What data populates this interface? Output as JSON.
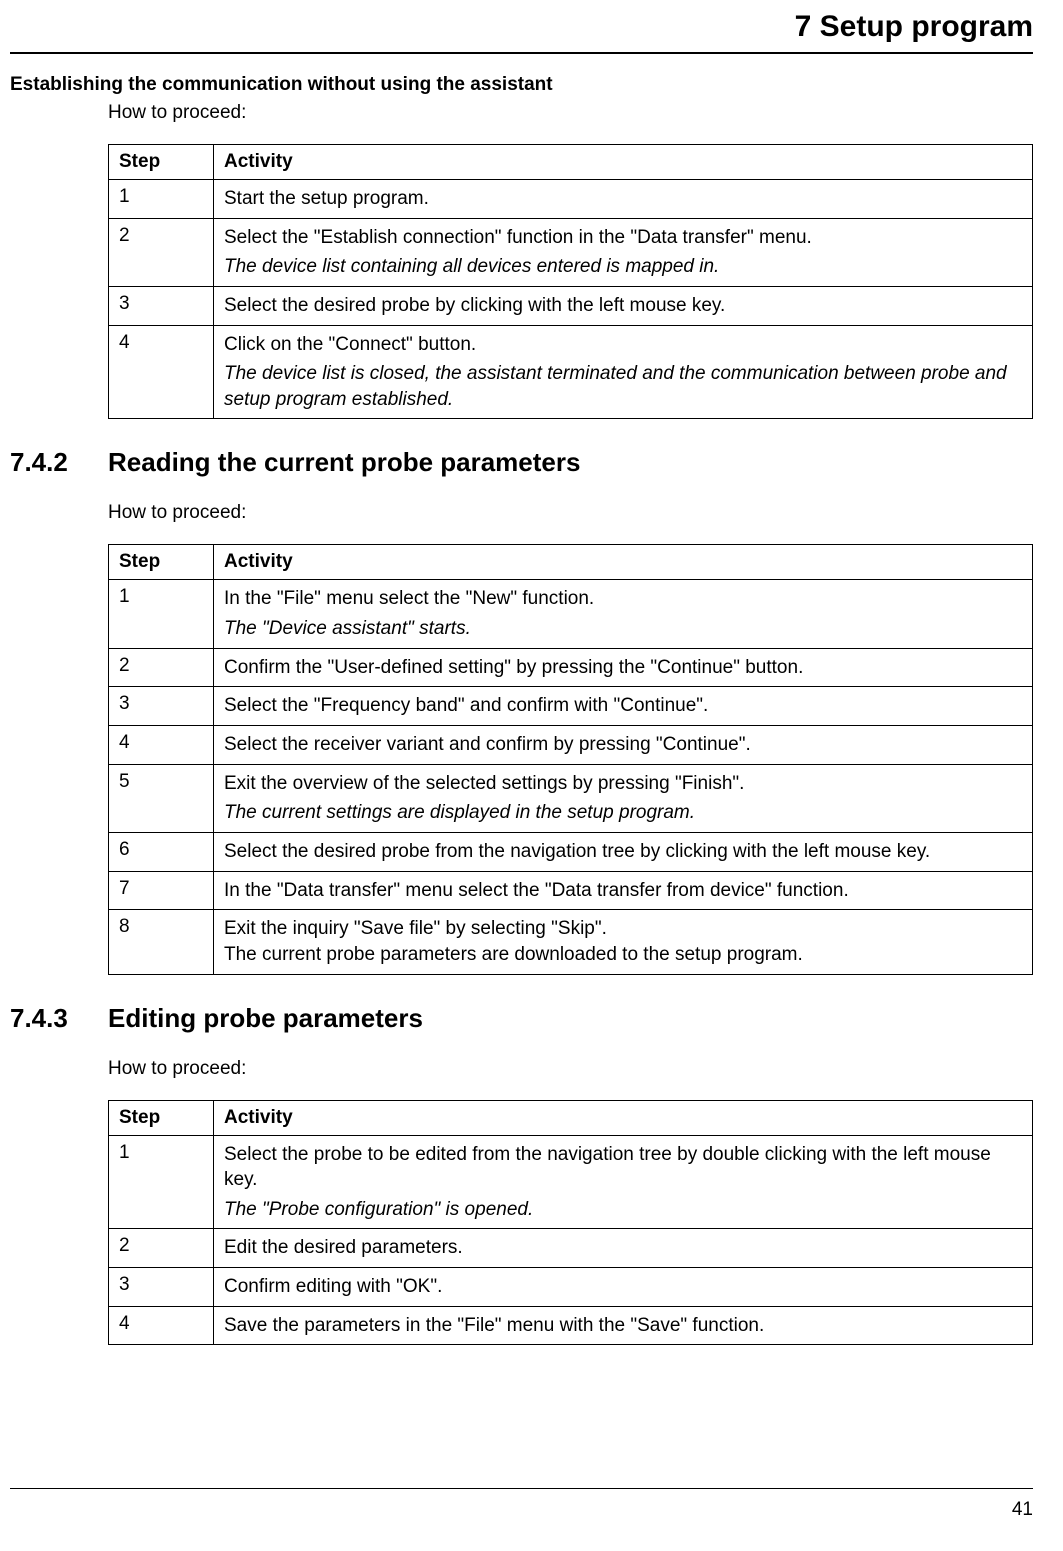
{
  "chapter_title": "7 Setup program",
  "page_number": "41",
  "section0": {
    "heading": "Establishing the communication without using the assistant",
    "proceed": "How to proceed:",
    "table": {
      "header_step": "Step",
      "header_activity": "Activity",
      "rows": [
        {
          "step": "1",
          "lines": [
            {
              "text": "Start the setup program.",
              "italic": false
            }
          ]
        },
        {
          "step": "2",
          "lines": [
            {
              "text": "Select the \"Establish connection\" function in the \"Data transfer\" menu.",
              "italic": false
            },
            {
              "text": "The device list containing all devices entered is mapped in.",
              "italic": true
            }
          ]
        },
        {
          "step": "3",
          "lines": [
            {
              "text": "Select the desired probe by clicking with the left mouse key.",
              "italic": false
            }
          ]
        },
        {
          "step": "4",
          "lines": [
            {
              "text": "Click on the \"Connect\" button.",
              "italic": false
            },
            {
              "text": "The device list is closed, the assistant terminated and the communication between probe and setup program established.",
              "italic": true
            }
          ]
        }
      ]
    }
  },
  "section1": {
    "number": "7.4.2",
    "title": "Reading the current probe parameters",
    "proceed": "How to proceed:",
    "table": {
      "header_step": "Step",
      "header_activity": "Activity",
      "rows": [
        {
          "step": "1",
          "lines": [
            {
              "text": "In the \"File\" menu select the \"New\" function.",
              "italic": false
            },
            {
              "text": "The \"Device assistant\" starts.",
              "italic": true
            }
          ]
        },
        {
          "step": "2",
          "lines": [
            {
              "text": "Confirm the \"User-defined setting\" by pressing the \"Continue\" button.",
              "italic": false
            }
          ]
        },
        {
          "step": "3",
          "lines": [
            {
              "text": "Select the \"Frequency band\" and confirm with \"Continue\".",
              "italic": false
            }
          ]
        },
        {
          "step": "4",
          "lines": [
            {
              "text": "Select the receiver variant and confirm by pressing \"Continue\".",
              "italic": false
            }
          ]
        },
        {
          "step": "5",
          "lines": [
            {
              "text": "Exit the overview of the selected settings by pressing \"Finish\".",
              "italic": false
            },
            {
              "text": "The current settings are displayed in the setup program.",
              "italic": true
            }
          ]
        },
        {
          "step": "6",
          "lines": [
            {
              "text": "Select the desired probe from the navigation tree by clicking with the left mouse key.",
              "italic": false
            }
          ]
        },
        {
          "step": "7",
          "lines": [
            {
              "text": "In the \"Data transfer\" menu select the \"Data transfer from device\" function.",
              "italic": false
            }
          ]
        },
        {
          "step": "8",
          "lines": [
            {
              "text": "Exit the inquiry \"Save file\" by selecting \"Skip\".",
              "italic": false
            },
            {
              "text": "The current probe parameters are downloaded to the setup program.",
              "italic": false
            }
          ]
        }
      ]
    }
  },
  "section2": {
    "number": "7.4.3",
    "title": "Editing probe parameters",
    "proceed": "How to proceed:",
    "table": {
      "header_step": "Step",
      "header_activity": "Activity",
      "rows": [
        {
          "step": "1",
          "lines": [
            {
              "text": "Select the probe to be edited from the navigation tree by double clicking with the left mouse key.",
              "italic": false
            },
            {
              "text": "The \"Probe configuration\" is opened.",
              "italic": true
            }
          ]
        },
        {
          "step": "2",
          "lines": [
            {
              "text": "Edit the desired parameters.",
              "italic": false
            }
          ]
        },
        {
          "step": "3",
          "lines": [
            {
              "text": "Confirm editing with \"OK\".",
              "italic": false
            }
          ]
        },
        {
          "step": "4",
          "lines": [
            {
              "text": "Save the parameters in the \"File\" menu with the \"Save\" function.",
              "italic": false
            }
          ]
        }
      ]
    }
  }
}
